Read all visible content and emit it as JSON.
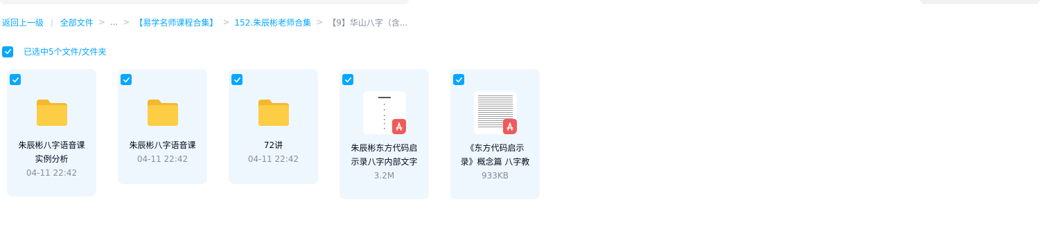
{
  "breadcrumb": {
    "back": "返回上一级",
    "all_files": "全部文件",
    "ellipsis": "...",
    "crumb1": "【易学名师课程合集】",
    "crumb2": "152.朱辰彬老师合集",
    "current": "【9】华山八字（含..."
  },
  "selection": {
    "text": "已选中5个文件/文件夹"
  },
  "files": [
    {
      "name_line1": "朱辰彬八字语音课",
      "name_line2": "实例分析",
      "meta": "04-11 22:42",
      "icon": "folder-icon"
    },
    {
      "name_line1": "朱辰彬八字语音课",
      "meta": "04-11 22:42",
      "icon": "folder-icon"
    },
    {
      "name_line1": "72讲",
      "meta": "04-11 22:42",
      "icon": "folder-icon"
    },
    {
      "name_line1": "朱辰彬东方代码启",
      "name_line2": "示录八字内部文字",
      "meta": "3.2M",
      "icon": "pdf-icon"
    },
    {
      "name_line1": "《东方代码启示",
      "name_line2": "录》概念篇 八字教",
      "meta": "933KB",
      "icon": "pdf-icon"
    }
  ],
  "colors": {
    "accent": "#06a7ff",
    "card_bg": "#eef7fe",
    "folder": "#fcc63a",
    "pdf": "#f05a5a"
  }
}
